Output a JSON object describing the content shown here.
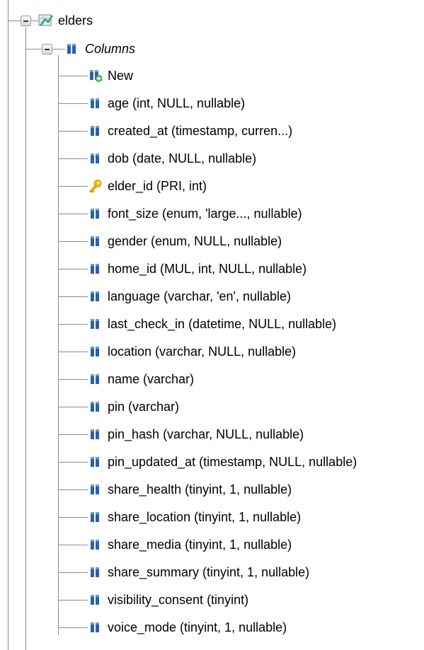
{
  "tree": {
    "table": {
      "label": "elders",
      "icon": "table-icon"
    },
    "columns_group": {
      "label": "Columns",
      "icon": "columns-icon"
    },
    "columns": [
      {
        "label": "New",
        "icon": "new-column-icon"
      },
      {
        "label": "age (int, NULL, nullable)",
        "icon": "column-icon"
      },
      {
        "label": "created_at (timestamp, curren...)",
        "icon": "column-icon"
      },
      {
        "label": "dob (date, NULL, nullable)",
        "icon": "column-icon"
      },
      {
        "label": "elder_id (PRI, int)",
        "icon": "primary-key-icon"
      },
      {
        "label": "font_size (enum, 'large..., nullable)",
        "icon": "column-icon"
      },
      {
        "label": "gender (enum, NULL, nullable)",
        "icon": "column-icon"
      },
      {
        "label": "home_id (MUL, int, NULL, nullable)",
        "icon": "column-icon"
      },
      {
        "label": "language (varchar, 'en', nullable)",
        "icon": "column-icon"
      },
      {
        "label": "last_check_in (datetime, NULL, nullable)",
        "icon": "column-icon"
      },
      {
        "label": "location (varchar, NULL, nullable)",
        "icon": "column-icon"
      },
      {
        "label": "name (varchar)",
        "icon": "column-icon"
      },
      {
        "label": "pin (varchar)",
        "icon": "column-icon"
      },
      {
        "label": "pin_hash (varchar, NULL, nullable)",
        "icon": "column-icon"
      },
      {
        "label": "pin_updated_at (timestamp, NULL, nullable)",
        "icon": "column-icon"
      },
      {
        "label": "share_health (tinyint, 1, nullable)",
        "icon": "column-icon"
      },
      {
        "label": "share_location (tinyint, 1, nullable)",
        "icon": "column-icon"
      },
      {
        "label": "share_media (tinyint, 1, nullable)",
        "icon": "column-icon"
      },
      {
        "label": "share_summary (tinyint, 1, nullable)",
        "icon": "column-icon"
      },
      {
        "label": "visibility_consent (tinyint)",
        "icon": "column-icon"
      },
      {
        "label": "voice_mode (tinyint, 1, nullable)",
        "icon": "column-icon"
      }
    ]
  },
  "colors": {
    "column_bar": "#2a5fb0",
    "tree_line": "#8c8c8c",
    "key": "#f2c200",
    "new_plus": "#3aa53a"
  }
}
